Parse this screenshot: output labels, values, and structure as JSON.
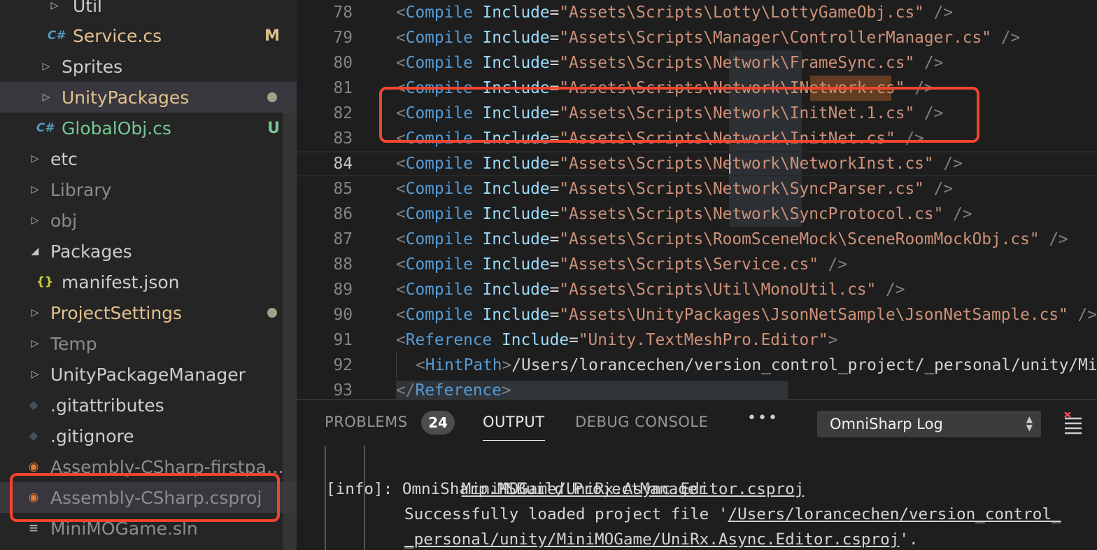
{
  "sidebar": {
    "items": [
      {
        "label": "Util"
      },
      {
        "label": "Service.cs",
        "badge": "M"
      },
      {
        "label": "Sprites"
      },
      {
        "label": "UnityPackages"
      },
      {
        "label": "GlobalObj.cs",
        "badge": "U"
      },
      {
        "label": "etc"
      },
      {
        "label": "Library"
      },
      {
        "label": "obj"
      },
      {
        "label": "Packages"
      },
      {
        "label": "manifest.json"
      },
      {
        "label": "ProjectSettings"
      },
      {
        "label": "Temp"
      },
      {
        "label": "UnityPackageManager"
      },
      {
        "label": ".gitattributes"
      },
      {
        "label": ".gitignore"
      },
      {
        "label": "Assembly-CSharp-firstpass.csproj"
      },
      {
        "label": "Assembly-CSharp.csproj"
      },
      {
        "label": "MiniMOGame.sln"
      }
    ]
  },
  "editor": {
    "lines": [
      {
        "n": "78",
        "tag": "Compile",
        "attr": "Include",
        "value": "\"Assets\\Scripts\\Lotty\\LottyGameObj.cs\"",
        "end": " />"
      },
      {
        "n": "79",
        "tag": "Compile",
        "attr": "Include",
        "value": "\"Assets\\Scripts\\Manager\\ControllerManager.cs\"",
        "end": " />"
      },
      {
        "n": "80",
        "tag": "Compile",
        "attr": "Include",
        "value": "\"Assets\\Scripts\\Network\\FrameSync.cs\"",
        "end": " />"
      },
      {
        "n": "81",
        "tag": "Compile",
        "attr": "Include",
        "value": "\"Assets\\Scripts\\Network\\INetwork.cs\"",
        "end": " />"
      },
      {
        "n": "82",
        "tag": "Compile",
        "attr": "Include",
        "value": "\"Assets\\Scripts\\Network\\InitNet.1.cs\"",
        "end": " />"
      },
      {
        "n": "83",
        "tag": "Compile",
        "attr": "Include",
        "value": "\"Assets\\Scripts\\Network\\InitNet.cs\"",
        "end": " />"
      },
      {
        "n": "84",
        "tag": "Compile",
        "attr": "Include",
        "value": "\"Assets\\Scripts\\Network\\NetworkInst.cs\"",
        "end": " />"
      },
      {
        "n": "85",
        "tag": "Compile",
        "attr": "Include",
        "value": "\"Assets\\Scripts\\Network\\SyncParser.cs\"",
        "end": " />"
      },
      {
        "n": "86",
        "tag": "Compile",
        "attr": "Include",
        "value": "\"Assets\\Scripts\\Network\\SyncProtocol.cs\"",
        "end": " />"
      },
      {
        "n": "87",
        "tag": "Compile",
        "attr": "Include",
        "value": "\"Assets\\Scripts\\RoomSceneMock\\SceneRoomMockObj.cs\"",
        "end": " />"
      },
      {
        "n": "88",
        "tag": "Compile",
        "attr": "Include",
        "value": "\"Assets\\Scripts\\Service.cs\"",
        "end": " />"
      },
      {
        "n": "89",
        "tag": "Compile",
        "attr": "Include",
        "value": "\"Assets\\Scripts\\Util\\MonoUtil.cs\"",
        "end": " />"
      },
      {
        "n": "90",
        "tag": "Compile",
        "attr": "Include",
        "value": "\"Assets\\UnityPackages\\JsonNetSample\\JsonNetSample.cs\"",
        "end": " />"
      },
      {
        "n": "91",
        "tag": "Reference",
        "attr": "Include",
        "value": "\"Unity.TextMeshPro.Editor\"",
        "end": ">"
      },
      {
        "n": "92",
        "tag": "HintPath",
        "text": "/Users/lorancechen/version_control_project/_personal/unity/MiniMOGame"
      },
      {
        "n": "93",
        "tag": "/Reference",
        "end": ">"
      }
    ]
  },
  "panel": {
    "tabs": {
      "problems": "PROBLEMS",
      "problems_count": "24",
      "output": "OUTPUT",
      "debug_console": "DEBUG CONSOLE",
      "more": "•••"
    },
    "output_channel": "OmniSharp Log",
    "output_lines": {
      "l1_cont": "MiniMOGame/UniRx.Async.Editor.csproj",
      "l2_prefix": "[info]: ",
      "l2_text": "OmniSharp.MSBuild.ProjectManager",
      "l3_text": "Successfully loaded project file '",
      "l3_path": "/Users/lorancechen/version_control_",
      "l4_path": "_personal/unity/MiniMOGame/UniRx.Async.Editor.csproj",
      "l4_end": "'."
    }
  },
  "colors": {
    "highlight_box": "#f0452e",
    "modified": "#e2c08d",
    "untracked": "#73c991"
  }
}
